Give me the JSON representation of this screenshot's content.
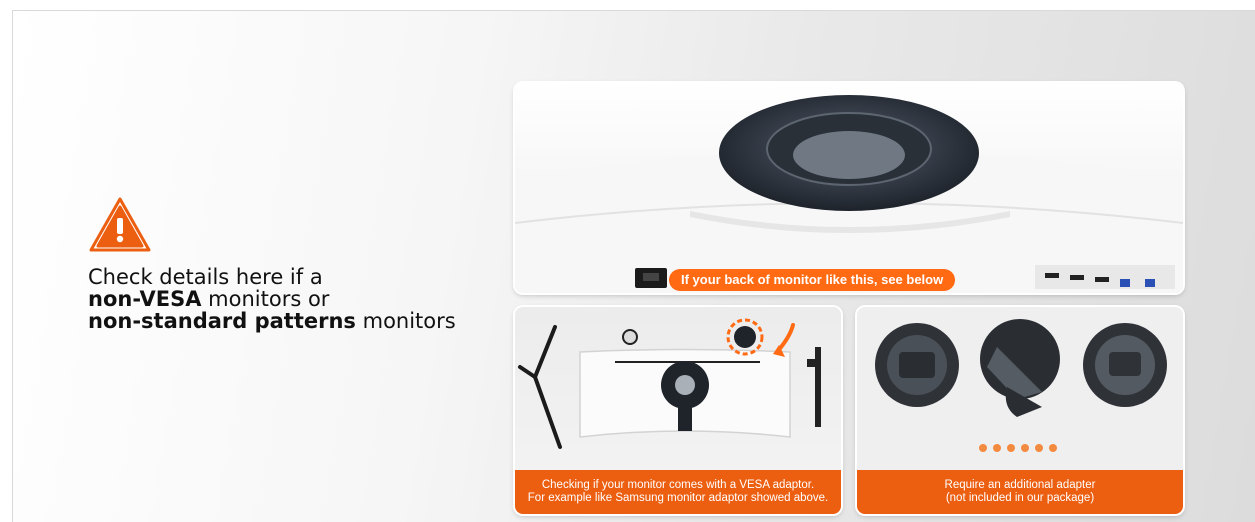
{
  "notice": {
    "icon": "warning-triangle-icon",
    "line1": "Check details here if a",
    "line2_bold": "non-VESA",
    "line2_rest": " monitors or",
    "line3_bold": "non-standard patterns",
    "line3_rest": " monitors"
  },
  "top_panel": {
    "badge": "If your back of monitor like this, see below"
  },
  "left_panel": {
    "caption_line1": "Checking if your monitor comes with a VESA adaptor.",
    "caption_line2": "For example like Samsung monitor adaptor showed above."
  },
  "right_panel": {
    "caption_line1": "Require an additional adapter",
    "caption_line2": "(not included in our package)",
    "dots": 6
  },
  "colors": {
    "accent": "#ec5e10",
    "badge": "#ff6a13",
    "dots": "#f28a3f"
  }
}
